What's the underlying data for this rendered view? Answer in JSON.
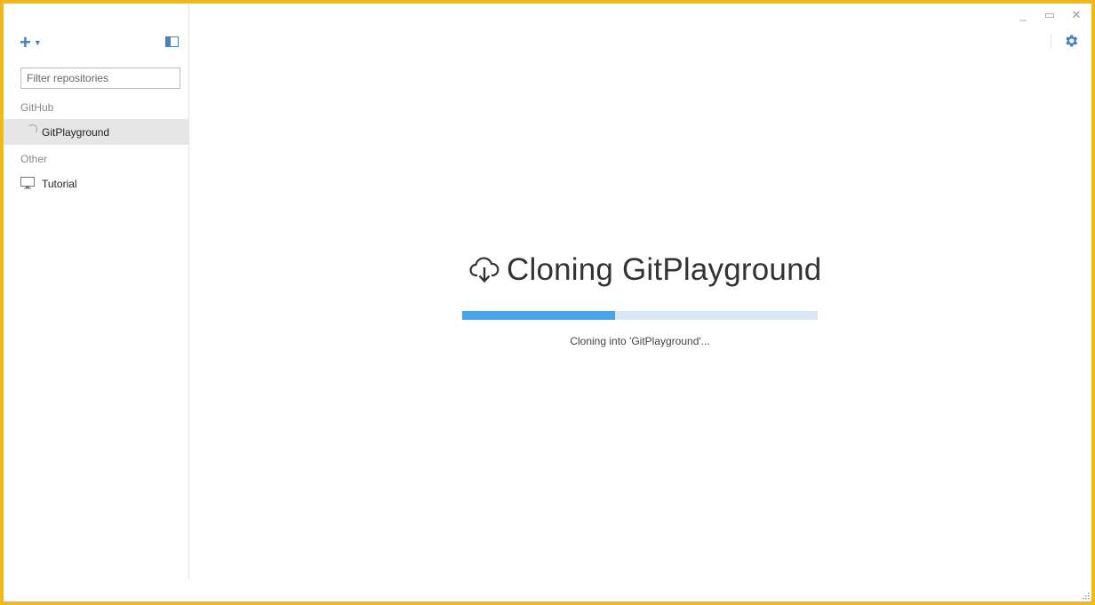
{
  "window": {
    "controls": {
      "minimize": "_",
      "maximize": "▭",
      "close": "✕"
    }
  },
  "sidebar": {
    "add_icon": "plus-icon",
    "filter": {
      "placeholder": "Filter repositories",
      "value": ""
    },
    "sections": [
      {
        "label": "GitHub",
        "repos": [
          {
            "name": "GitPlayground",
            "icon": "spinner-icon",
            "selected": true
          }
        ]
      },
      {
        "label": "Other",
        "repos": [
          {
            "name": "Tutorial",
            "icon": "monitor-icon",
            "selected": false
          }
        ]
      }
    ]
  },
  "main": {
    "title": "Cloning GitPlayground",
    "title_icon": "cloud-download-icon",
    "progress": 0.43,
    "status": "Cloning into 'GitPlayground'..."
  },
  "colors": {
    "accent": "#4a7fb9",
    "progress_fill": "#4aa3e6",
    "progress_track": "#d9e6f4",
    "desktop_border": "#f3b71a",
    "selected_row": "#e6e6e6"
  }
}
